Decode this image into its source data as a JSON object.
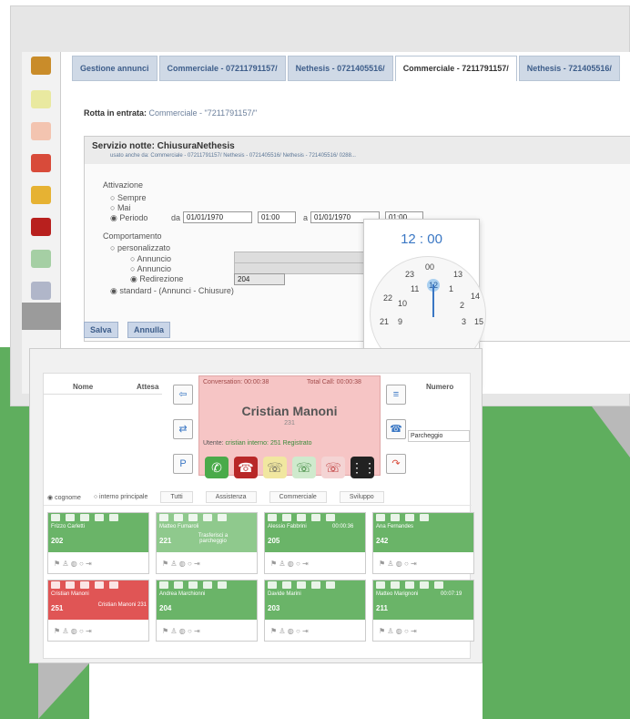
{
  "back_window": {
    "tabs": [
      "Gestione annunci",
      "Commerciale - 07211791157/",
      "Nethesis - 0721405516/",
      "Commerciale - 7211791157/",
      "Nethesis - 721405516/"
    ],
    "route_label": "Rotta in entrata:",
    "route_value": "Commerciale - \"7211791157/\"",
    "service_title": "Servizio notte: ChiusuraNethesis",
    "service_sub": "usato anche da: Commerciale - 07211791157/ Nethesis - 0721405516/ Nethesis - 721405516/ 0288...",
    "activation_label": "Attivazione",
    "opt_always": "Sempre",
    "opt_never": "Mai",
    "opt_period": "Periodo",
    "from_label": "da",
    "from_date": "01/01/1970",
    "from_time": "01:00",
    "to_label": "a",
    "to_date": "01/01/1970",
    "to_time": "01:00",
    "behaviour_label": "Comportamento",
    "opt_custom": "personalizzato",
    "opt_announce1": "Annuncio",
    "opt_announce2": "Annuncio",
    "opt_redirect": "Redirezione",
    "redirect_value": "204",
    "opt_standard": "standard - (Annunci - Chiusure)",
    "save_label": "Salva",
    "cancel_label": "Annulla",
    "clock_time": "12 : 00",
    "clock_numbers": [
      "00",
      "13",
      "23",
      "12",
      "1",
      "14",
      "22",
      "11",
      "10",
      "2",
      "21",
      "9",
      "3",
      "15"
    ]
  },
  "front_window": {
    "col_name": "Nome",
    "col_wait": "Attesa",
    "col_number": "Numero",
    "parking": "Parcheggio",
    "conversation": "Conversation: 00:00:38",
    "total_calls": "Total Call: 00:00:38",
    "caller_name": "Cristian Manoni",
    "caller_ext": "231",
    "user_info_label": "Utente:",
    "user_info_value": "cristian interno: 251 Registrato",
    "filter_radio1": "cognome",
    "filter_radio2": "interno principale",
    "filter_tabs": [
      "Tutti",
      "Assistenza",
      "Commerciale",
      "Sviluppo"
    ],
    "cards": [
      {
        "name": "Frizzo Carletti",
        "num": "202",
        "sub": ""
      },
      {
        "name": "Matteo Fumaroli",
        "num": "221",
        "sub": "Trasferisci a parcheggio"
      },
      {
        "name": "Alessio Fabbrini",
        "num": "205",
        "sub": "00:00:36"
      },
      {
        "name": "Ana Fernandes",
        "num": "242",
        "sub": ""
      },
      {
        "name": "Cristian Manoni",
        "num": "251",
        "sub": "Cristian Manoni 231"
      },
      {
        "name": "Andrea Marchionni",
        "num": "204",
        "sub": ""
      },
      {
        "name": "Davide Marini",
        "num": "203",
        "sub": ""
      },
      {
        "name": "Matteo Marignoni",
        "num": "211",
        "sub": "00:07:19"
      }
    ]
  },
  "colors": {
    "green": "#5fae5e",
    "card_green": "#6ab468",
    "card_red": "#e05555",
    "call_pink": "#f6c5c5"
  }
}
